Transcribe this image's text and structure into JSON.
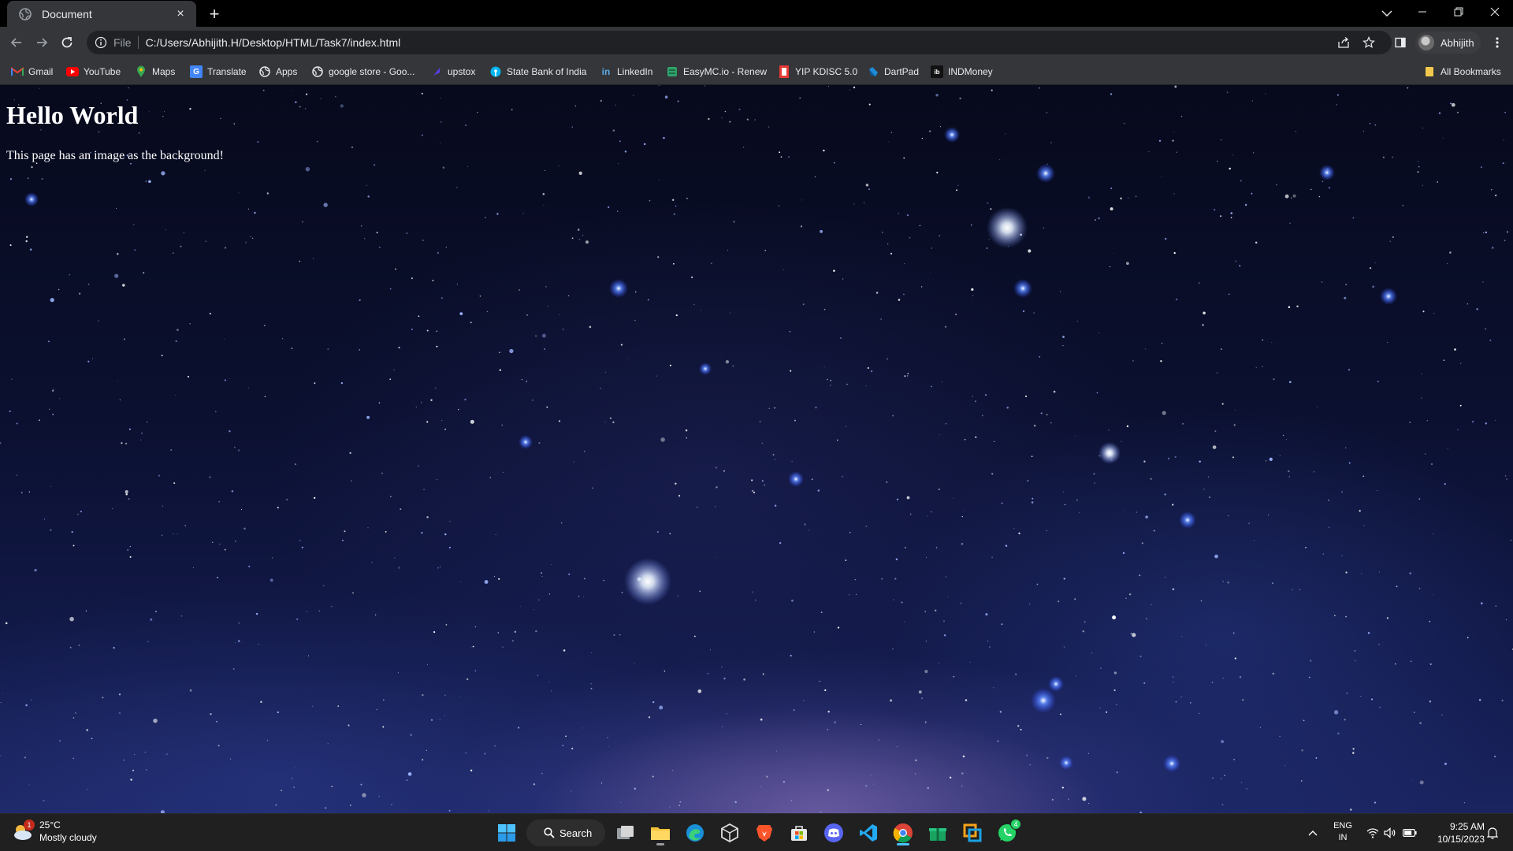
{
  "browser": {
    "tab": {
      "title": "Document",
      "close_glyph": "×"
    },
    "new_tab_glyph": "+",
    "omnibox": {
      "chip": "File",
      "url": "C:/Users/Abhijith.H/Desktop/HTML/Task7/index.html"
    },
    "profile_name": "Abhijith",
    "bookmarks": [
      {
        "label": "Gmail",
        "icon": "gmail-icon"
      },
      {
        "label": "YouTube",
        "icon": "youtube-icon"
      },
      {
        "label": "Maps",
        "icon": "maps-icon"
      },
      {
        "label": "Translate",
        "icon": "translate-icon"
      },
      {
        "label": "Apps",
        "icon": "globe-icon"
      },
      {
        "label": "google store - Goo...",
        "icon": "globe-icon"
      },
      {
        "label": "upstox",
        "icon": "upstox-icon"
      },
      {
        "label": "State Bank of India",
        "icon": "sbi-icon"
      },
      {
        "label": "LinkedIn",
        "icon": "linkedin-icon"
      },
      {
        "label": "EasyMC.io - Renew",
        "icon": "easymc-icon"
      },
      {
        "label": "YIP KDISC 5.0",
        "icon": "yip-icon"
      },
      {
        "label": "DartPad",
        "icon": "dart-icon"
      },
      {
        "label": "INDMoney",
        "icon": "indmoney-icon"
      }
    ],
    "all_bookmarks_label": "All Bookmarks"
  },
  "page": {
    "heading": "Hello World",
    "paragraph": "This page has an image as the background!"
  },
  "taskbar": {
    "weather": {
      "temp": "25°C",
      "condition": "Mostly cloudy",
      "badge": "1"
    },
    "search_label": "Search",
    "language": {
      "line1": "ENG",
      "line2": "IN"
    },
    "clock": {
      "time": "9:25 AM",
      "date": "10/15/2023"
    },
    "whatsapp_badge": "4"
  },
  "colors": {
    "tab_bg": "#35363a",
    "omnibox_bg": "#202124",
    "taskbar_bg": "#202020",
    "text": "#e8eaed"
  }
}
